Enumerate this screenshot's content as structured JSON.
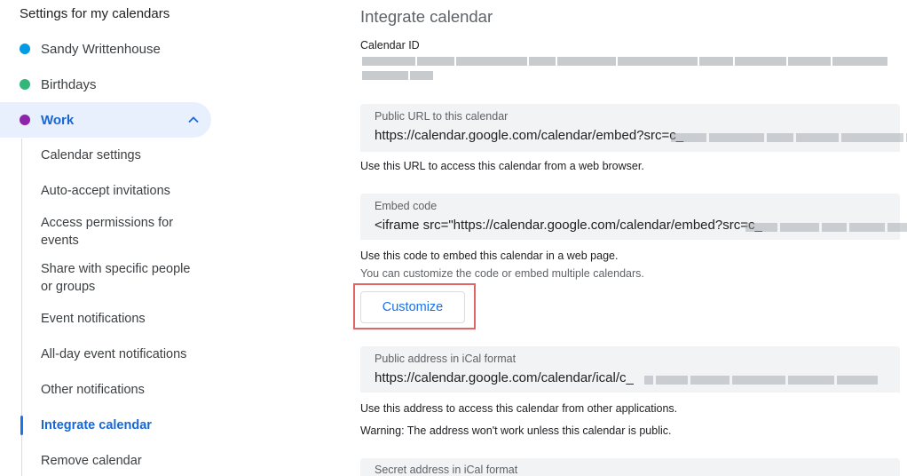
{
  "sidebar": {
    "heading": "Settings for my calendars",
    "calendars": [
      {
        "label": "Sandy Writtenhouse",
        "color": "#039be5"
      },
      {
        "label": "Birthdays",
        "color": "#33b679"
      },
      {
        "label": "Work",
        "color": "#8e24aa"
      }
    ],
    "sub_items": [
      {
        "label": "Calendar settings"
      },
      {
        "label": "Auto-accept invitations"
      },
      {
        "label": "Access permissions for events"
      },
      {
        "label": "Share with specific people or groups"
      },
      {
        "label": "Event notifications"
      },
      {
        "label": "All-day event notifications"
      },
      {
        "label": "Other notifications"
      },
      {
        "label": "Integrate calendar"
      },
      {
        "label": "Remove calendar"
      }
    ],
    "active_sub_item": "Integrate calendar",
    "expand_icon": "chevron-up-icon"
  },
  "main": {
    "title": "Integrate calendar",
    "calendar_id_label": "Calendar ID",
    "public_url": {
      "label": "Public URL to this calendar",
      "value": "https://calendar.google.com/calendar/embed?src=c_",
      "help": "Use this URL to access this calendar from a web browser."
    },
    "embed": {
      "label": "Embed code",
      "value": "<iframe src=\"https://calendar.google.com/calendar/embed?src=c_",
      "help1": "Use this code to embed this calendar in a web page.",
      "help2": "You can customize the code or embed multiple calendars."
    },
    "customize_label": "Customize",
    "public_ical": {
      "label": "Public address in iCal format",
      "value": "https://calendar.google.com/calendar/ical/c_",
      "help": "Use this address to access this calendar from other applications.",
      "warning": "Warning: The address won't work unless this calendar is public."
    },
    "secret_ical": {
      "label": "Secret address in iCal format"
    }
  },
  "colors": {
    "accent": "#1a73e8",
    "active_bg": "#e8f0fe",
    "highlight_border": "#e06666"
  }
}
